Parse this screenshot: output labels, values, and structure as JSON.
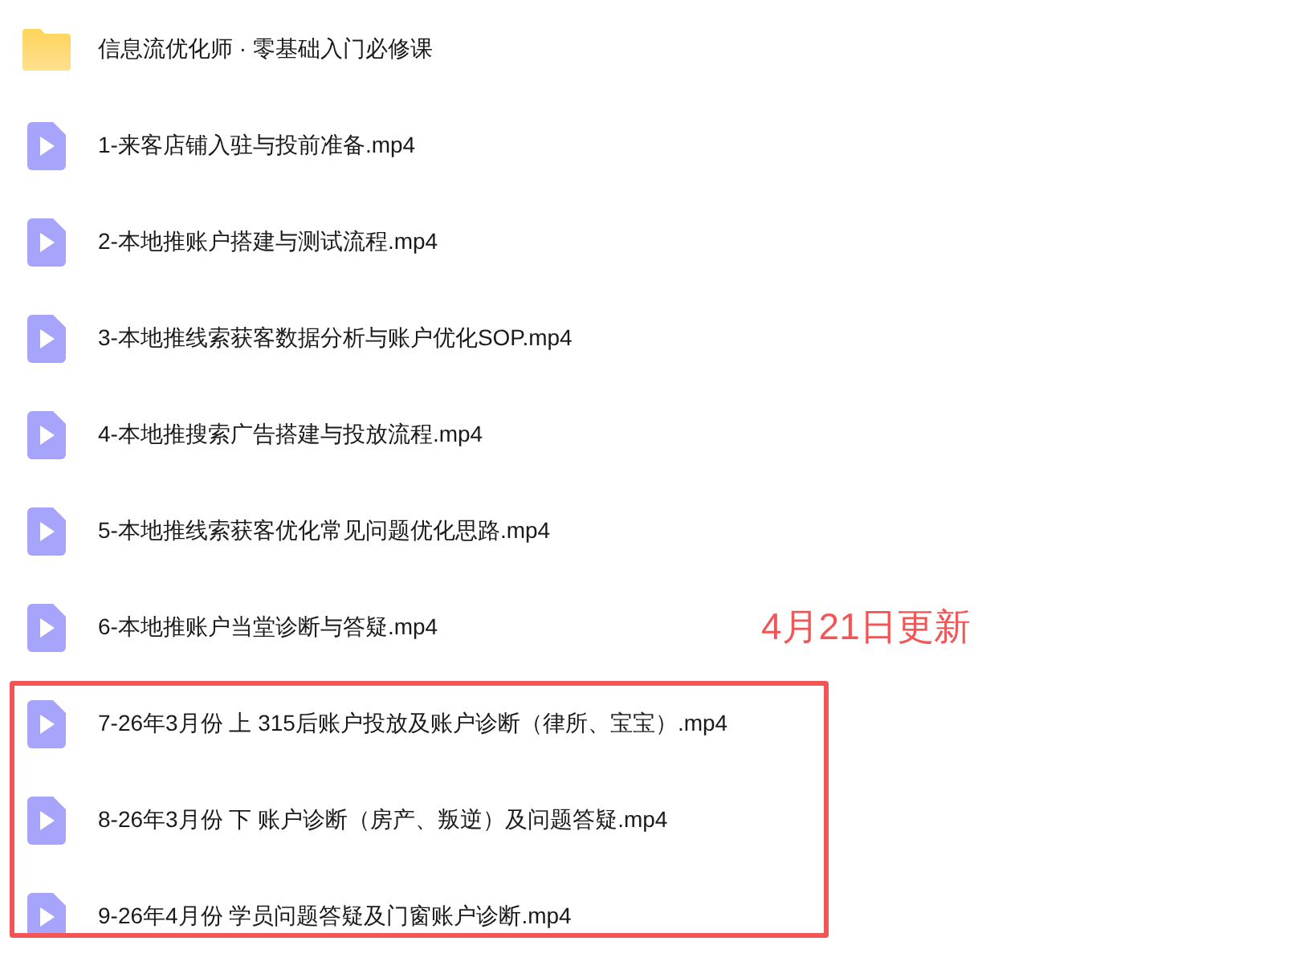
{
  "items": [
    {
      "kind": "folder",
      "name": "信息流优化师 · 零基础入门必修课"
    },
    {
      "kind": "video",
      "name": "1-来客店铺入驻与投前准备.mp4"
    },
    {
      "kind": "video",
      "name": "2-本地推账户搭建与测试流程.mp4"
    },
    {
      "kind": "video",
      "name": "3-本地推线索获客数据分析与账户优化SOP.mp4"
    },
    {
      "kind": "video",
      "name": "4-本地推搜索广告搭建与投放流程.mp4"
    },
    {
      "kind": "video",
      "name": "5-本地推线索获客优化常见问题优化思路.mp4"
    },
    {
      "kind": "video",
      "name": "6-本地推账户当堂诊断与答疑.mp4"
    }
  ],
  "annotation": {
    "label": "4月21日更新"
  },
  "highlighted_items": [
    {
      "kind": "video",
      "name": "7-26年3月份 上 315后账户投放及账户诊断（律所、宝宝）.mp4"
    },
    {
      "kind": "video",
      "name": "8-26年3月份 下 账户诊断（房产、叛逆）及问题答疑.mp4"
    },
    {
      "kind": "video",
      "name": "9-26年4月份 学员问题答疑及门窗账户诊断.mp4"
    }
  ]
}
